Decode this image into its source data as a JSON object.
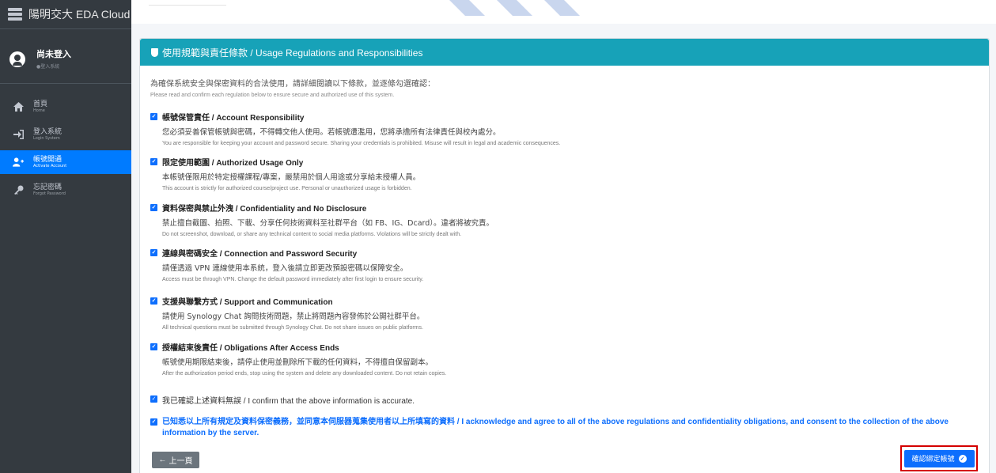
{
  "app": {
    "title": "陽明交大 EDA Cloud"
  },
  "user": {
    "name": "尚未登入",
    "status": "●登入系統"
  },
  "sidebar": {
    "items": [
      {
        "label": "首頁",
        "sub": "Home",
        "icon": "home-icon",
        "active": false
      },
      {
        "label": "登入系統",
        "sub": "Login System",
        "icon": "login-icon",
        "active": false
      },
      {
        "label": "帳號開通",
        "sub": "Activate Account",
        "icon": "user-plus-icon",
        "active": true
      },
      {
        "label": "忘記密碼",
        "sub": "Forgot Password",
        "icon": "key-icon",
        "active": false
      }
    ]
  },
  "card": {
    "header": "使用規範與責任條款 / Usage Regulations and Responsibilities",
    "intro_zh": "為確保系統安全與保密資料的合法使用，請詳細閱讀以下條款，並逐條勾選確認：",
    "intro_en": "Please read and confirm each regulation below to ensure secure and authorized use of this system.",
    "rules": [
      {
        "title": "帳號保管責任 / Account Responsibility",
        "zh": "您必須妥善保管帳號與密碼，不得轉交他人使用。若帳號遭濫用，您將承擔所有法律責任與校內處分。",
        "en": "You are responsible for keeping your account and password secure. Sharing your credentials is prohibited. Misuse will result in legal and academic consequences."
      },
      {
        "title": "限定使用範圍 / Authorized Usage Only",
        "zh": "本帳號僅限用於特定授權課程/專案，嚴禁用於個人用途或分享給未授權人員。",
        "en": "This account is strictly for authorized course/project use. Personal or unauthorized usage is forbidden."
      },
      {
        "title": "資料保密與禁止外洩 / Confidentiality and No Disclosure",
        "zh": "禁止擅自截圖、拍照、下載、分享任何技術資料至社群平台（如 FB、IG、Dcard）。違者將被究責。",
        "en": "Do not screenshot, download, or share any technical content to social media platforms. Violations will be strictly dealt with."
      },
      {
        "title": "連線與密碼安全 / Connection and Password Security",
        "zh": "請僅透過 VPN 連線使用本系統，登入後請立即更改預設密碼以保障安全。",
        "en": "Access must be through VPN. Change the default password immediately after first login to ensure security."
      },
      {
        "title": "支援與聯繫方式 / Support and Communication",
        "zh": "請使用 Synology Chat 詢問技術問題，禁止將問題內容發佈於公開社群平台。",
        "en": "All technical questions must be submitted through Synology Chat. Do not share issues on public platforms."
      },
      {
        "title": "授權結束後責任 / Obligations After Access Ends",
        "zh": "帳號使用期限結束後，請停止使用並刪除所下載的任何資料，不得擅自保留副本。",
        "en": "After the authorization period ends, stop using the system and delete any downloaded content. Do not retain copies."
      }
    ],
    "confirm1": "我已確認上述資料無誤 / I confirm that the above information is accurate.",
    "confirm2": "已知悉以上所有規定及資料保密義務，並同意本伺服器蒐集使用者以上所填寫的資料 / I acknowledge and agree to all of the above regulations and confidentiality obligations, and consent to the collection of the above information by the server.",
    "back_button": "上一頁",
    "confirm_button": "確認綁定帳號"
  },
  "colors": {
    "sidebar_bg": "#343a40",
    "header_bg": "#17a2b8",
    "primary": "#0d6efd",
    "active_nav": "#007bff",
    "highlight_border": "#d40000"
  }
}
